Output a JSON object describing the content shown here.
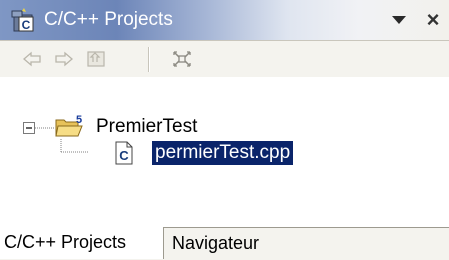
{
  "view": {
    "title": "C/C++ Projects",
    "title_icon": "cpp-projects-icon",
    "menu_icon": "view-menu-triangle-icon",
    "close_label": "×"
  },
  "toolbar": {
    "buttons": [
      {
        "icon": "back-arrow-icon"
      },
      {
        "icon": "forward-arrow-icon"
      },
      {
        "icon": "up-folder-icon"
      },
      {
        "icon": "collapse-all-icon"
      }
    ]
  },
  "tree": {
    "project": {
      "label": "PremierTest",
      "icon": "project-folder-icon",
      "expand_symbol": "−"
    },
    "file": {
      "label": "permierTest.cpp",
      "icon": "cpp-file-icon",
      "selected": true
    }
  },
  "tabs": [
    {
      "label": "C/C++ Projects",
      "active": true
    },
    {
      "label": "Navigateur",
      "active": false
    }
  ],
  "colors": {
    "selection_bg": "#0a246a",
    "toolbar_bg": "#f4f3ee",
    "title_gradient_start": "#7f97c4"
  }
}
